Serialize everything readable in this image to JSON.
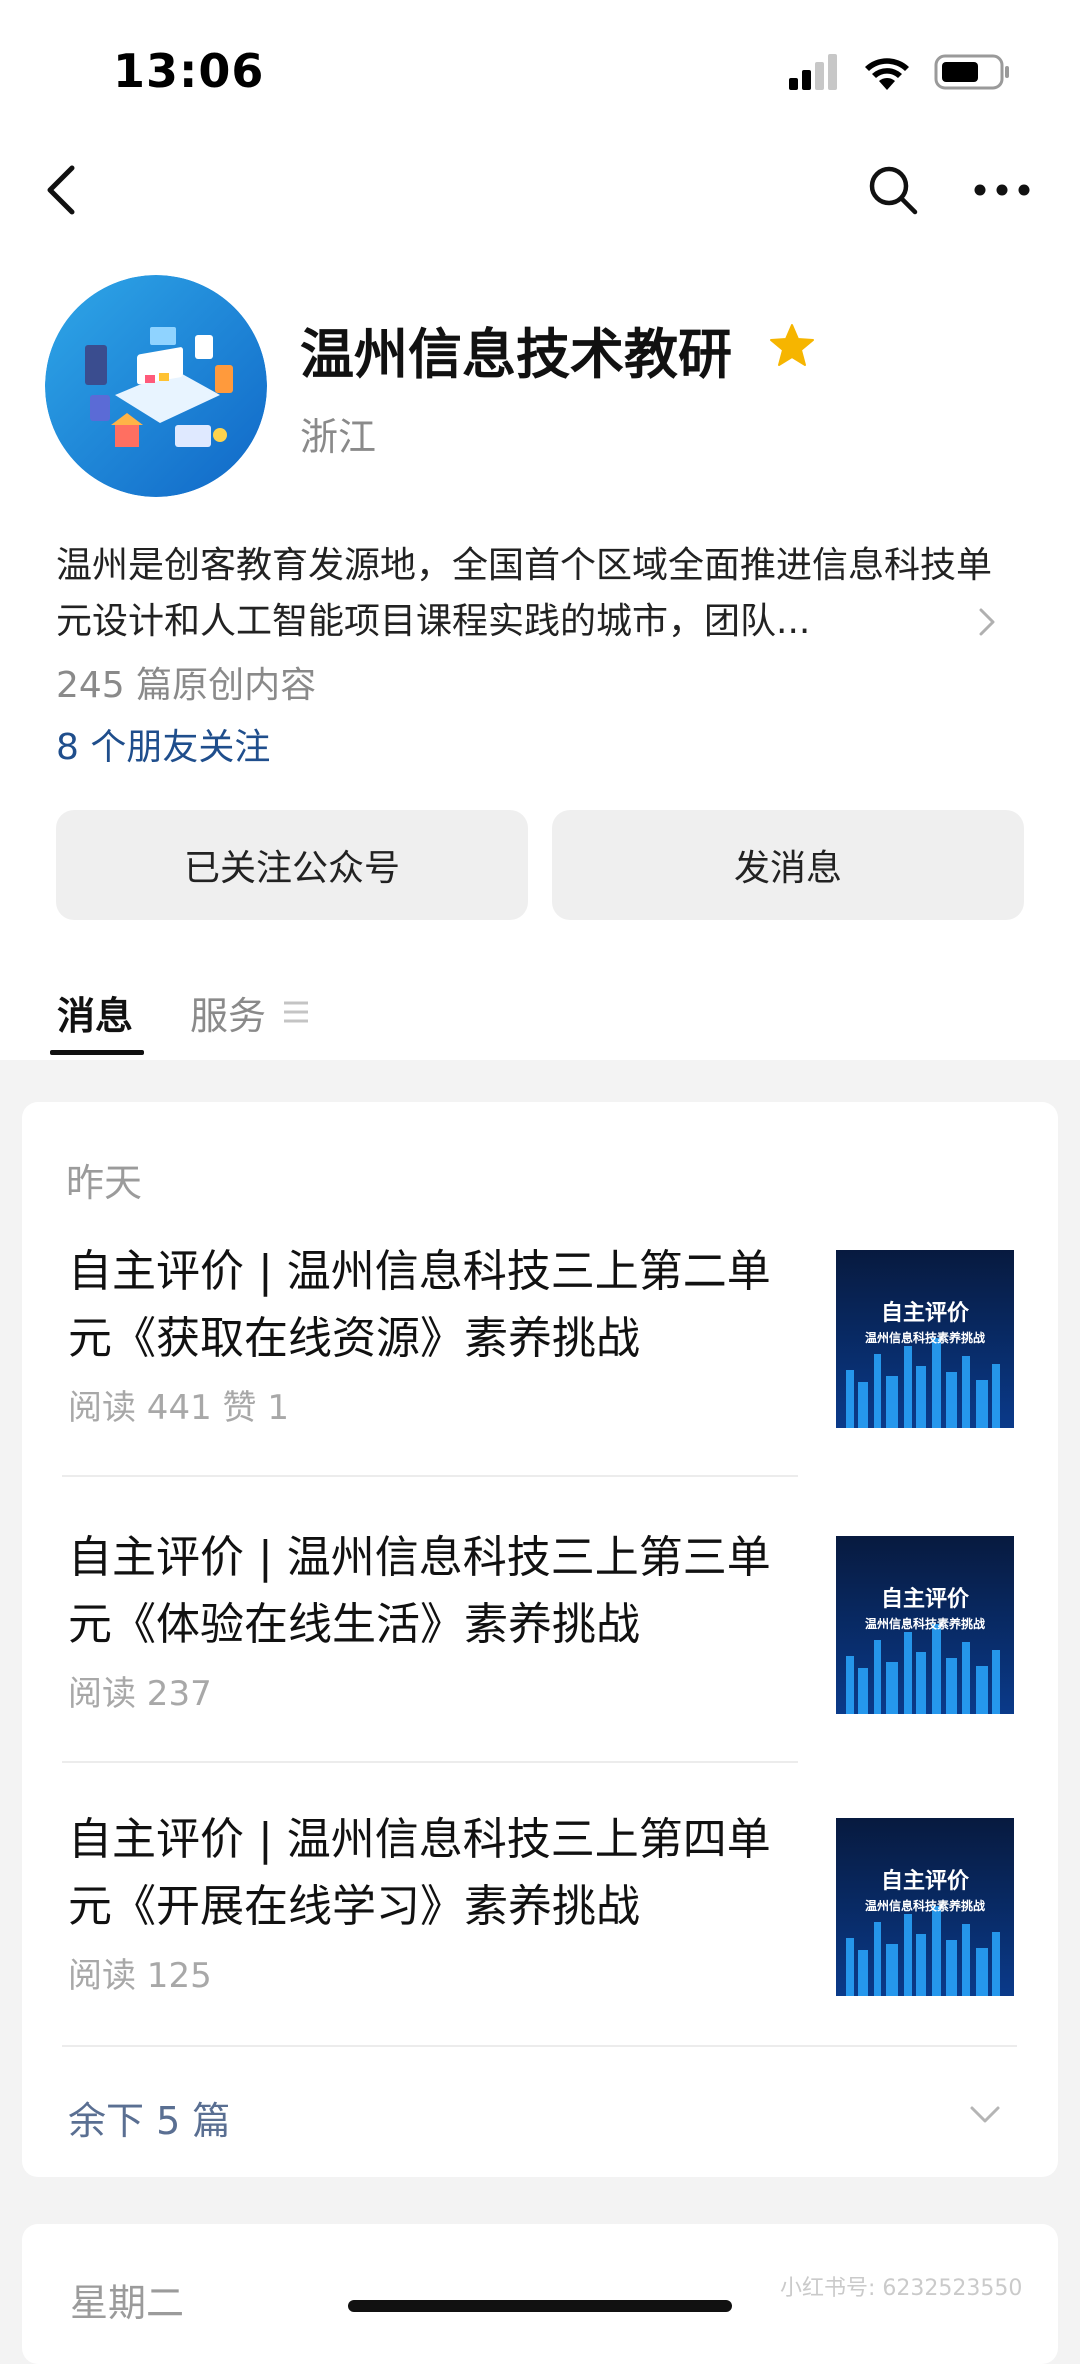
{
  "status_bar": {
    "time": "13:06"
  },
  "account": {
    "name": "温州信息技术教研",
    "region": "浙江",
    "description": "温州是创客教育发源地，全国首个区域全面推进信息科技单元设计和人工智能项目课程实践的城市，团队...",
    "original_count": "245 篇原创内容",
    "friends_follow": "8 个朋友关注"
  },
  "buttons": {
    "followed": "已关注公众号",
    "message": "发消息"
  },
  "tabs": {
    "messages": "消息",
    "services": "服务"
  },
  "feed": {
    "date_yesterday": "昨天",
    "articles": [
      {
        "title": "自主评价 | 温州信息科技三上第二单元《获取在线资源》素养挑战",
        "meta": "阅读 441  赞 1",
        "thumb_title": "自主评价",
        "thumb_sub": "温州信息科技素养挑战"
      },
      {
        "title": "自主评价 | 温州信息科技三上第三单元《体验在线生活》素养挑战",
        "meta": "阅读 237",
        "thumb_title": "自主评价",
        "thumb_sub": "温州信息科技素养挑战"
      },
      {
        "title": "自主评价 | 温州信息科技三上第四单元《开展在线学习》素养挑战",
        "meta": "阅读 125",
        "thumb_title": "自主评价",
        "thumb_sub": "温州信息科技素养挑战"
      }
    ],
    "remaining": "余下 5 篇",
    "date_tuesday": "星期二"
  },
  "watermark": "小红书号: 6232523550",
  "colors": {
    "link_blue": "#1f4e8c",
    "star": "#f6b500",
    "remaining_text": "#5a6f92"
  },
  "icons": [
    "back-icon",
    "search-icon",
    "more-icon",
    "star-icon",
    "chevron-right-icon",
    "menu-icon",
    "chevron-down-icon"
  ]
}
